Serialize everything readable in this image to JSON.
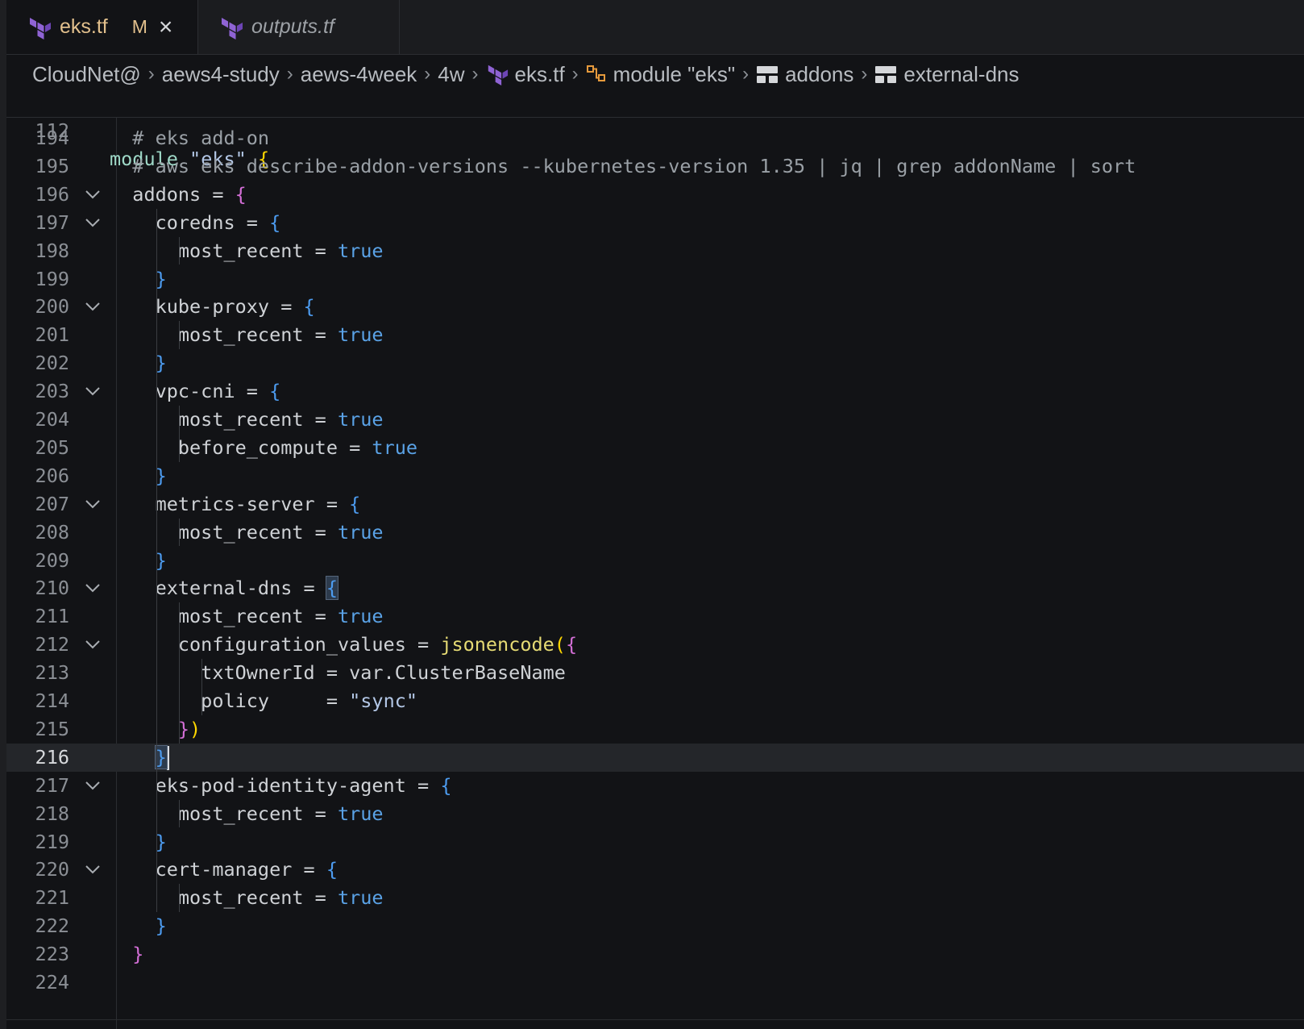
{
  "tabs": [
    {
      "label": "eks.tf",
      "modified": "M",
      "close": "×"
    },
    {
      "label": "outputs.tf"
    }
  ],
  "breadcrumb": [
    "CloudNet@",
    "aews4-study",
    "aews-4week",
    "4w",
    "eks.tf",
    "module \"eks\"",
    "addons",
    "external-dns"
  ],
  "breadcrumb_sep": "›",
  "colors": {
    "background": "#121316",
    "keyword": "#9ed8c7",
    "string": "#b3c7e6",
    "comment": "#9aa0a6",
    "bool": "#5aa2e6",
    "function": "#e6db74",
    "brace_pink": "#d46fd7",
    "brace_blue": "#4d9cf0",
    "brace_yellow": "#ffd700",
    "terraform": "#8f63d4"
  },
  "sticky_line": {
    "num": "112",
    "tokens": [
      [
        "kw",
        "module"
      ],
      [
        "t",
        " "
      ],
      [
        "str",
        "\"eks\""
      ],
      [
        "t",
        " "
      ],
      [
        "by",
        "{"
      ]
    ]
  },
  "code_lines": [
    {
      "num": "194",
      "fold": false,
      "tokens": [
        [
          "t",
          "  "
        ],
        [
          "cm",
          "# eks add-on"
        ]
      ]
    },
    {
      "num": "195",
      "fold": false,
      "tokens": [
        [
          "t",
          "  "
        ],
        [
          "cm",
          "# aws eks describe-addon-versions --kubernetes-version 1.35 | jq | grep addonName | sort"
        ]
      ]
    },
    {
      "num": "196",
      "fold": true,
      "tokens": [
        [
          "t",
          "  addons = "
        ],
        [
          "bp",
          "{"
        ]
      ]
    },
    {
      "num": "197",
      "fold": true,
      "tokens": [
        [
          "t",
          "    coredns = "
        ],
        [
          "bb",
          "{"
        ]
      ]
    },
    {
      "num": "198",
      "fold": false,
      "tokens": [
        [
          "t",
          "      most_recent = "
        ],
        [
          "bool",
          "true"
        ]
      ]
    },
    {
      "num": "199",
      "fold": false,
      "tokens": [
        [
          "t",
          "    "
        ],
        [
          "bb",
          "}"
        ]
      ]
    },
    {
      "num": "200",
      "fold": true,
      "tokens": [
        [
          "t",
          "    kube-proxy = "
        ],
        [
          "bb",
          "{"
        ]
      ]
    },
    {
      "num": "201",
      "fold": false,
      "tokens": [
        [
          "t",
          "      most_recent = "
        ],
        [
          "bool",
          "true"
        ]
      ]
    },
    {
      "num": "202",
      "fold": false,
      "tokens": [
        [
          "t",
          "    "
        ],
        [
          "bb",
          "}"
        ]
      ]
    },
    {
      "num": "203",
      "fold": true,
      "tokens": [
        [
          "t",
          "    vpc-cni = "
        ],
        [
          "bb",
          "{"
        ]
      ]
    },
    {
      "num": "204",
      "fold": false,
      "tokens": [
        [
          "t",
          "      most_recent = "
        ],
        [
          "bool",
          "true"
        ]
      ]
    },
    {
      "num": "205",
      "fold": false,
      "tokens": [
        [
          "t",
          "      before_compute = "
        ],
        [
          "bool",
          "true"
        ]
      ]
    },
    {
      "num": "206",
      "fold": false,
      "tokens": [
        [
          "t",
          "    "
        ],
        [
          "bb",
          "}"
        ]
      ]
    },
    {
      "num": "207",
      "fold": true,
      "tokens": [
        [
          "t",
          "    metrics-server = "
        ],
        [
          "bb",
          "{"
        ]
      ]
    },
    {
      "num": "208",
      "fold": false,
      "tokens": [
        [
          "t",
          "      most_recent = "
        ],
        [
          "bool",
          "true"
        ]
      ]
    },
    {
      "num": "209",
      "fold": false,
      "tokens": [
        [
          "t",
          "    "
        ],
        [
          "bb",
          "}"
        ]
      ]
    },
    {
      "num": "210",
      "fold": true,
      "tokens": [
        [
          "t",
          "    external-dns = "
        ],
        [
          "bbm",
          "{"
        ]
      ]
    },
    {
      "num": "211",
      "fold": false,
      "tokens": [
        [
          "t",
          "      most_recent = "
        ],
        [
          "bool",
          "true"
        ]
      ]
    },
    {
      "num": "212",
      "fold": true,
      "tokens": [
        [
          "t",
          "      configuration_values = "
        ],
        [
          "fn",
          "jsonencode"
        ],
        [
          "by",
          "("
        ],
        [
          "bp",
          "{"
        ]
      ]
    },
    {
      "num": "213",
      "fold": false,
      "tokens": [
        [
          "t",
          "        txtOwnerId = var.ClusterBaseName"
        ]
      ]
    },
    {
      "num": "214",
      "fold": false,
      "tokens": [
        [
          "t",
          "        policy     = "
        ],
        [
          "str",
          "\"sync\""
        ]
      ]
    },
    {
      "num": "215",
      "fold": false,
      "tokens": [
        [
          "t",
          "      "
        ],
        [
          "bp",
          "}"
        ],
        [
          "by",
          ")"
        ]
      ]
    },
    {
      "num": "216",
      "fold": false,
      "current": true,
      "tokens": [
        [
          "t",
          "    "
        ],
        [
          "bbm",
          "}"
        ],
        [
          "cur",
          ""
        ]
      ]
    },
    {
      "num": "217",
      "fold": true,
      "tokens": [
        [
          "t",
          "    eks-pod-identity-agent = "
        ],
        [
          "bb",
          "{"
        ]
      ]
    },
    {
      "num": "218",
      "fold": false,
      "tokens": [
        [
          "t",
          "      most_recent = "
        ],
        [
          "bool",
          "true"
        ]
      ]
    },
    {
      "num": "219",
      "fold": false,
      "tokens": [
        [
          "t",
          "    "
        ],
        [
          "bb",
          "}"
        ]
      ]
    },
    {
      "num": "220",
      "fold": true,
      "tokens": [
        [
          "t",
          "    cert-manager = "
        ],
        [
          "bb",
          "{"
        ]
      ]
    },
    {
      "num": "221",
      "fold": false,
      "tokens": [
        [
          "t",
          "      most_recent = "
        ],
        [
          "bool",
          "true"
        ]
      ]
    },
    {
      "num": "222",
      "fold": false,
      "tokens": [
        [
          "t",
          "    "
        ],
        [
          "bb",
          "}"
        ]
      ]
    },
    {
      "num": "223",
      "fold": false,
      "tokens": [
        [
          "t",
          "  "
        ],
        [
          "bp",
          "}"
        ]
      ]
    },
    {
      "num": "224",
      "fold": false,
      "tokens": []
    }
  ]
}
